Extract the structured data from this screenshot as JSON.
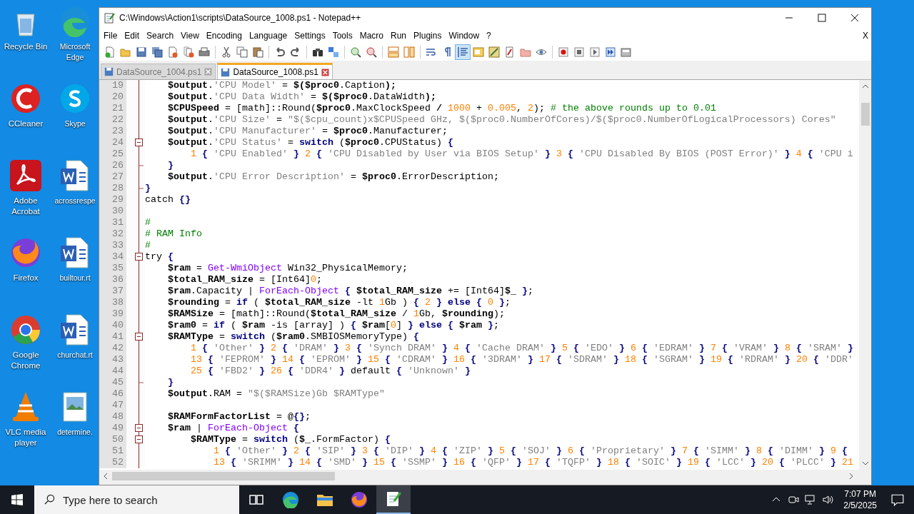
{
  "desktop_icons": [
    {
      "label": "Recycle Bin",
      "kind": "recycle"
    },
    {
      "label": "Microsoft Edge",
      "kind": "edge"
    },
    {
      "label": "CCleaner",
      "kind": "ccleaner"
    },
    {
      "label": "Skype",
      "kind": "skype"
    },
    {
      "label": "Adobe Acrobat",
      "kind": "acrobat"
    },
    {
      "label": "acrossrespe",
      "kind": "word"
    },
    {
      "label": "Firefox",
      "kind": "firefox"
    },
    {
      "label": "builtour.rt",
      "kind": "word"
    },
    {
      "label": "Google Chrome",
      "kind": "chrome"
    },
    {
      "label": "churchat.rt",
      "kind": "word"
    },
    {
      "label": "VLC media player",
      "kind": "vlc"
    },
    {
      "label": "determine.",
      "kind": "image"
    }
  ],
  "window": {
    "title": "C:\\Windows\\Action1\\scripts\\DataSource_1008.ps1 - Notepad++",
    "menu": [
      "File",
      "Edit",
      "Search",
      "View",
      "Encoding",
      "Language",
      "Settings",
      "Tools",
      "Macro",
      "Run",
      "Plugins",
      "Window",
      "?"
    ],
    "close_doc": "X",
    "indent_guide_on": true,
    "tabs": [
      {
        "label": "DataSource_1004.ps1",
        "selected": false
      },
      {
        "label": "DataSource_1008.ps1",
        "selected": true
      }
    ]
  },
  "editor": {
    "lines": [
      {
        "n": "19",
        "tokens": [
          {
            "kind": "var",
            "text": "    $output"
          },
          {
            "kind": "plain",
            "text": "."
          },
          {
            "kind": "str",
            "text": "'CPU Model'"
          },
          {
            "kind": "plain",
            "text": " = "
          },
          {
            "kind": "var",
            "text": "$($proc0"
          },
          {
            "kind": "plain",
            "text": ".Caption"
          },
          {
            "kind": "var",
            "text": ");"
          }
        ]
      },
      {
        "n": "20",
        "tokens": [
          {
            "kind": "var",
            "text": "    $output"
          },
          {
            "kind": "plain",
            "text": "."
          },
          {
            "kind": "str",
            "text": "'CPU Data Width'"
          },
          {
            "kind": "plain",
            "text": " = "
          },
          {
            "kind": "var",
            "text": "$($proc0"
          },
          {
            "kind": "plain",
            "text": ".DataWidth"
          },
          {
            "kind": "var",
            "text": ");"
          }
        ]
      },
      {
        "n": "21",
        "tokens": [
          {
            "kind": "var",
            "text": "    $CPUSpeed"
          },
          {
            "kind": "plain",
            "text": " = [math]::Round("
          },
          {
            "kind": "var",
            "text": "$proc0"
          },
          {
            "kind": "plain",
            "text": ".MaxClockSpeed "
          },
          {
            "kind": "var",
            "text": "/ "
          },
          {
            "kind": "num",
            "text": "1000"
          },
          {
            "kind": "plain",
            "text": " + "
          },
          {
            "kind": "num",
            "text": "0.005"
          },
          {
            "kind": "plain",
            "text": ", "
          },
          {
            "kind": "num",
            "text": "2"
          },
          {
            "kind": "plain",
            "text": "); "
          },
          {
            "kind": "comment",
            "text": "# the above rounds up to 0.01"
          }
        ]
      },
      {
        "n": "22",
        "tokens": [
          {
            "kind": "var",
            "text": "    $output"
          },
          {
            "kind": "plain",
            "text": "."
          },
          {
            "kind": "str",
            "text": "'CPU Size'"
          },
          {
            "kind": "plain",
            "text": " = "
          },
          {
            "kind": "str",
            "text": "\"$($cpu_count)x$CPUSpeed GHz, $($proc0.NumberOfCores)/$($proc0.NumberOfLogicalProcessors) Cores\""
          }
        ]
      },
      {
        "n": "23",
        "tokens": [
          {
            "kind": "var",
            "text": "    $output"
          },
          {
            "kind": "plain",
            "text": "."
          },
          {
            "kind": "str",
            "text": "'CPU Manufacturer'"
          },
          {
            "kind": "plain",
            "text": " = "
          },
          {
            "kind": "var",
            "text": "$proc0"
          },
          {
            "kind": "plain",
            "text": ".Manufacturer;"
          }
        ]
      },
      {
        "n": "24",
        "kind": "fold_start",
        "tokens": [
          {
            "kind": "var",
            "text": "    $output"
          },
          {
            "kind": "plain",
            "text": "."
          },
          {
            "kind": "str",
            "text": "'CPU Status'"
          },
          {
            "kind": "plain",
            "text": " = "
          },
          {
            "kind": "keyword",
            "text": "switch"
          },
          {
            "kind": "plain",
            "text": " ("
          },
          {
            "kind": "var",
            "text": "$proc0"
          },
          {
            "kind": "plain",
            "text": ".CPUStatus) "
          },
          {
            "kind": "brace",
            "text": "{"
          }
        ]
      },
      {
        "n": "25",
        "tokens": [
          {
            "kind": "num",
            "text": "        1"
          },
          {
            "kind": "brace",
            "text": " { "
          },
          {
            "kind": "str",
            "text": "'CPU Enabled'"
          },
          {
            "kind": "brace",
            "text": " } "
          },
          {
            "kind": "num",
            "text": "2"
          },
          {
            "kind": "brace",
            "text": " { "
          },
          {
            "kind": "str",
            "text": "'CPU Disabled by User via BIOS Setup'"
          },
          {
            "kind": "brace",
            "text": " } "
          },
          {
            "kind": "num",
            "text": "3"
          },
          {
            "kind": "brace",
            "text": " { "
          },
          {
            "kind": "str",
            "text": "'CPU Disabled By BIOS (POST Error)'"
          },
          {
            "kind": "brace",
            "text": " } "
          },
          {
            "kind": "num",
            "text": "4"
          },
          {
            "kind": "brace",
            "text": " { "
          },
          {
            "kind": "str",
            "text": "'CPU i"
          }
        ]
      },
      {
        "n": "26",
        "kind": "fold_end",
        "tokens": [
          {
            "kind": "brace",
            "text": "    }"
          }
        ]
      },
      {
        "n": "27",
        "tokens": [
          {
            "kind": "var",
            "text": "    $output"
          },
          {
            "kind": "plain",
            "text": "."
          },
          {
            "kind": "str",
            "text": "'CPU Error Description'"
          },
          {
            "kind": "plain",
            "text": " = "
          },
          {
            "kind": "var",
            "text": "$proc0"
          },
          {
            "kind": "plain",
            "text": ".ErrorDescription;"
          }
        ]
      },
      {
        "n": "28",
        "kind": "fold_end",
        "tokens": [
          {
            "kind": "brace",
            "text": "}"
          }
        ]
      },
      {
        "n": "29",
        "tokens": [
          {
            "kind": "plain",
            "text": "catch "
          },
          {
            "kind": "brace",
            "text": "{}"
          }
        ]
      },
      {
        "n": "30",
        "kind": "blank"
      },
      {
        "n": "31",
        "tokens": [
          {
            "kind": "comment",
            "text": "#"
          }
        ]
      },
      {
        "n": "32",
        "tokens": [
          {
            "kind": "comment",
            "text": "# RAM Info"
          }
        ]
      },
      {
        "n": "33",
        "tokens": [
          {
            "kind": "comment",
            "text": "#"
          }
        ]
      },
      {
        "n": "34",
        "kind": "fold_start",
        "tokens": [
          {
            "kind": "plain",
            "text": "try "
          },
          {
            "kind": "brace",
            "text": "{"
          }
        ]
      },
      {
        "n": "35",
        "tokens": [
          {
            "kind": "var",
            "text": "    $ram"
          },
          {
            "kind": "plain",
            "text": " = "
          },
          {
            "kind": "cmdlet",
            "text": "Get-WmiObject"
          },
          {
            "kind": "plain",
            "text": " Win32_PhysicalMemory;"
          }
        ]
      },
      {
        "n": "36",
        "tokens": [
          {
            "kind": "var",
            "text": "    $total_RAM_size"
          },
          {
            "kind": "plain",
            "text": " = [Int64]"
          },
          {
            "kind": "num",
            "text": "0"
          },
          {
            "kind": "plain",
            "text": ";"
          }
        ]
      },
      {
        "n": "37",
        "tokens": [
          {
            "kind": "var",
            "text": "    $ram"
          },
          {
            "kind": "plain",
            "text": ".Capacity | "
          },
          {
            "kind": "cmdlet",
            "text": "ForEach-Object"
          },
          {
            "kind": "brace",
            "text": " { "
          },
          {
            "kind": "var",
            "text": "$total_RAM_size"
          },
          {
            "kind": "plain",
            "text": " += [Int64]"
          },
          {
            "kind": "var",
            "text": "$_"
          },
          {
            "kind": "brace",
            "text": " }"
          },
          {
            "kind": "plain",
            "text": ";"
          }
        ]
      },
      {
        "n": "38",
        "tokens": [
          {
            "kind": "var",
            "text": "    $rounding"
          },
          {
            "kind": "plain",
            "text": " = "
          },
          {
            "kind": "keyword",
            "text": "if"
          },
          {
            "kind": "plain",
            "text": " ( "
          },
          {
            "kind": "var",
            "text": "$total_RAM_size"
          },
          {
            "kind": "plain",
            "text": " -lt "
          },
          {
            "kind": "num",
            "text": "1"
          },
          {
            "kind": "plain",
            "text": "Gb ) "
          },
          {
            "kind": "brace",
            "text": "{ "
          },
          {
            "kind": "num",
            "text": "2"
          },
          {
            "kind": "brace",
            "text": " } "
          },
          {
            "kind": "keyword",
            "text": "else"
          },
          {
            "kind": "brace",
            "text": " { "
          },
          {
            "kind": "num",
            "text": "0"
          },
          {
            "kind": "brace",
            "text": " }"
          },
          {
            "kind": "plain",
            "text": ";"
          }
        ]
      },
      {
        "n": "39",
        "tokens": [
          {
            "kind": "var",
            "text": "    $RAMSize"
          },
          {
            "kind": "plain",
            "text": " = [math]::Round("
          },
          {
            "kind": "var",
            "text": "$total_RAM_size"
          },
          {
            "kind": "plain",
            "text": " / "
          },
          {
            "kind": "num",
            "text": "1"
          },
          {
            "kind": "plain",
            "text": "Gb, "
          },
          {
            "kind": "var",
            "text": "$rounding"
          },
          {
            "kind": "plain",
            "text": ");"
          }
        ]
      },
      {
        "n": "40",
        "tokens": [
          {
            "kind": "var",
            "text": "    $ram0"
          },
          {
            "kind": "plain",
            "text": " = "
          },
          {
            "kind": "keyword",
            "text": "if"
          },
          {
            "kind": "plain",
            "text": " ( "
          },
          {
            "kind": "var",
            "text": "$ram"
          },
          {
            "kind": "plain",
            "text": " -is [array] ) "
          },
          {
            "kind": "brace",
            "text": "{ "
          },
          {
            "kind": "var",
            "text": "$ram"
          },
          {
            "kind": "plain",
            "text": "["
          },
          {
            "kind": "num",
            "text": "0"
          },
          {
            "kind": "plain",
            "text": "]"
          },
          {
            "kind": "brace",
            "text": " } "
          },
          {
            "kind": "keyword",
            "text": "else"
          },
          {
            "kind": "brace",
            "text": " { "
          },
          {
            "kind": "var",
            "text": "$ram"
          },
          {
            "kind": "brace",
            "text": " }"
          },
          {
            "kind": "plain",
            "text": ";"
          }
        ]
      },
      {
        "n": "41",
        "kind": "fold_start",
        "tokens": [
          {
            "kind": "var",
            "text": "    $RAMType"
          },
          {
            "kind": "plain",
            "text": " = "
          },
          {
            "kind": "keyword",
            "text": "switch"
          },
          {
            "kind": "plain",
            "text": " ("
          },
          {
            "kind": "var",
            "text": "$ram0"
          },
          {
            "kind": "plain",
            "text": ".SMBIOSMemoryType) "
          },
          {
            "kind": "brace",
            "text": "{"
          }
        ]
      },
      {
        "n": "42",
        "tokens": [
          {
            "kind": "num",
            "text": "        1"
          },
          {
            "kind": "brace",
            "text": " { "
          },
          {
            "kind": "str",
            "text": "'Other'"
          },
          {
            "kind": "brace",
            "text": " } "
          },
          {
            "kind": "num",
            "text": "2"
          },
          {
            "kind": "brace",
            "text": " { "
          },
          {
            "kind": "str",
            "text": "'DRAM'"
          },
          {
            "kind": "brace",
            "text": " } "
          },
          {
            "kind": "num",
            "text": "3"
          },
          {
            "kind": "brace",
            "text": " { "
          },
          {
            "kind": "str",
            "text": "'Synch DRAM'"
          },
          {
            "kind": "brace",
            "text": " } "
          },
          {
            "kind": "num",
            "text": "4"
          },
          {
            "kind": "brace",
            "text": " { "
          },
          {
            "kind": "str",
            "text": "'Cache DRAM'"
          },
          {
            "kind": "brace",
            "text": " } "
          },
          {
            "kind": "num",
            "text": "5"
          },
          {
            "kind": "brace",
            "text": " { "
          },
          {
            "kind": "str",
            "text": "'EDO'"
          },
          {
            "kind": "brace",
            "text": " } "
          },
          {
            "kind": "num",
            "text": "6"
          },
          {
            "kind": "brace",
            "text": " { "
          },
          {
            "kind": "str",
            "text": "'EDRAM'"
          },
          {
            "kind": "brace",
            "text": " } "
          },
          {
            "kind": "num",
            "text": "7"
          },
          {
            "kind": "brace",
            "text": " { "
          },
          {
            "kind": "str",
            "text": "'VRAM'"
          },
          {
            "kind": "brace",
            "text": " } "
          },
          {
            "kind": "num",
            "text": "8"
          },
          {
            "kind": "brace",
            "text": " { "
          },
          {
            "kind": "str",
            "text": "'SRAM'"
          },
          {
            "kind": "brace",
            "text": " }"
          }
        ]
      },
      {
        "n": "43",
        "tokens": [
          {
            "kind": "num",
            "text": "        13"
          },
          {
            "kind": "brace",
            "text": " { "
          },
          {
            "kind": "str",
            "text": "'FEPROM'"
          },
          {
            "kind": "brace",
            "text": " } "
          },
          {
            "kind": "num",
            "text": "14"
          },
          {
            "kind": "brace",
            "text": " { "
          },
          {
            "kind": "str",
            "text": "'EPROM'"
          },
          {
            "kind": "brace",
            "text": " } "
          },
          {
            "kind": "num",
            "text": "15"
          },
          {
            "kind": "brace",
            "text": " { "
          },
          {
            "kind": "str",
            "text": "'CDRAM'"
          },
          {
            "kind": "brace",
            "text": " } "
          },
          {
            "kind": "num",
            "text": "16"
          },
          {
            "kind": "brace",
            "text": " { "
          },
          {
            "kind": "str",
            "text": "'3DRAM'"
          },
          {
            "kind": "brace",
            "text": " } "
          },
          {
            "kind": "num",
            "text": "17"
          },
          {
            "kind": "brace",
            "text": " { "
          },
          {
            "kind": "str",
            "text": "'SDRAM'"
          },
          {
            "kind": "brace",
            "text": " } "
          },
          {
            "kind": "num",
            "text": "18"
          },
          {
            "kind": "brace",
            "text": " { "
          },
          {
            "kind": "str",
            "text": "'SGRAM'"
          },
          {
            "kind": "brace",
            "text": " } "
          },
          {
            "kind": "num",
            "text": "19"
          },
          {
            "kind": "brace",
            "text": " { "
          },
          {
            "kind": "str",
            "text": "'RDRAM'"
          },
          {
            "kind": "brace",
            "text": " } "
          },
          {
            "kind": "num",
            "text": "20"
          },
          {
            "kind": "brace",
            "text": " { "
          },
          {
            "kind": "str",
            "text": "'DDR'"
          }
        ]
      },
      {
        "n": "44",
        "tokens": [
          {
            "kind": "num",
            "text": "        25"
          },
          {
            "kind": "brace",
            "text": " { "
          },
          {
            "kind": "str",
            "text": "'FBD2'"
          },
          {
            "kind": "brace",
            "text": " } "
          },
          {
            "kind": "num",
            "text": "26"
          },
          {
            "kind": "brace",
            "text": " { "
          },
          {
            "kind": "str",
            "text": "'DDR4'"
          },
          {
            "kind": "brace",
            "text": " } "
          },
          {
            "kind": "plain",
            "text": "default"
          },
          {
            "kind": "brace",
            "text": " { "
          },
          {
            "kind": "str",
            "text": "'Unknown'"
          },
          {
            "kind": "brace",
            "text": " }"
          }
        ]
      },
      {
        "n": "45",
        "kind": "fold_end",
        "tokens": [
          {
            "kind": "brace",
            "text": "    }"
          }
        ]
      },
      {
        "n": "46",
        "tokens": [
          {
            "kind": "var",
            "text": "    $output"
          },
          {
            "kind": "plain",
            "text": ".RAM = "
          },
          {
            "kind": "str",
            "text": "\"$($RAMSize)Gb $RAMType\""
          }
        ]
      },
      {
        "n": "47",
        "kind": "blank"
      },
      {
        "n": "48",
        "tokens": [
          {
            "kind": "var",
            "text": "    $RAMFormFactorList"
          },
          {
            "kind": "plain",
            "text": " = @"
          },
          {
            "kind": "brace",
            "text": "{}"
          },
          {
            "kind": "plain",
            "text": ";"
          }
        ]
      },
      {
        "n": "49",
        "kind": "fold_start",
        "tokens": [
          {
            "kind": "var",
            "text": "    $ram"
          },
          {
            "kind": "plain",
            "text": " | "
          },
          {
            "kind": "cmdlet",
            "text": "ForEach-Object"
          },
          {
            "kind": "brace",
            "text": " {"
          }
        ]
      },
      {
        "n": "50",
        "kind": "fold_start",
        "tokens": [
          {
            "kind": "var",
            "text": "        $RAMType"
          },
          {
            "kind": "plain",
            "text": " = "
          },
          {
            "kind": "keyword",
            "text": "switch"
          },
          {
            "kind": "plain",
            "text": " ("
          },
          {
            "kind": "var",
            "text": "$_"
          },
          {
            "kind": "plain",
            "text": ".FormFactor) "
          },
          {
            "kind": "brace",
            "text": "{"
          }
        ]
      },
      {
        "n": "51",
        "tokens": [
          {
            "kind": "num",
            "text": "            1"
          },
          {
            "kind": "brace",
            "text": " { "
          },
          {
            "kind": "str",
            "text": "'Other'"
          },
          {
            "kind": "brace",
            "text": " } "
          },
          {
            "kind": "num",
            "text": "2"
          },
          {
            "kind": "brace",
            "text": " { "
          },
          {
            "kind": "str",
            "text": "'SIP'"
          },
          {
            "kind": "brace",
            "text": " } "
          },
          {
            "kind": "num",
            "text": "3"
          },
          {
            "kind": "brace",
            "text": " { "
          },
          {
            "kind": "str",
            "text": "'DIP'"
          },
          {
            "kind": "brace",
            "text": " } "
          },
          {
            "kind": "num",
            "text": "4"
          },
          {
            "kind": "brace",
            "text": " { "
          },
          {
            "kind": "str",
            "text": "'ZIP'"
          },
          {
            "kind": "brace",
            "text": " } "
          },
          {
            "kind": "num",
            "text": "5"
          },
          {
            "kind": "brace",
            "text": " { "
          },
          {
            "kind": "str",
            "text": "'SOJ'"
          },
          {
            "kind": "brace",
            "text": " } "
          },
          {
            "kind": "num",
            "text": "6"
          },
          {
            "kind": "brace",
            "text": " { "
          },
          {
            "kind": "str",
            "text": "'Proprietary'"
          },
          {
            "kind": "brace",
            "text": " } "
          },
          {
            "kind": "num",
            "text": "7"
          },
          {
            "kind": "brace",
            "text": " { "
          },
          {
            "kind": "str",
            "text": "'SIMM'"
          },
          {
            "kind": "brace",
            "text": " } "
          },
          {
            "kind": "num",
            "text": "8"
          },
          {
            "kind": "brace",
            "text": " { "
          },
          {
            "kind": "str",
            "text": "'DIMM'"
          },
          {
            "kind": "brace",
            "text": " } "
          },
          {
            "kind": "num",
            "text": "9"
          },
          {
            "kind": "brace",
            "text": " {"
          }
        ]
      },
      {
        "n": "52",
        "tokens": [
          {
            "kind": "num",
            "text": "            13"
          },
          {
            "kind": "brace",
            "text": " { "
          },
          {
            "kind": "str",
            "text": "'SRIMM'"
          },
          {
            "kind": "brace",
            "text": " } "
          },
          {
            "kind": "num",
            "text": "14"
          },
          {
            "kind": "brace",
            "text": " { "
          },
          {
            "kind": "str",
            "text": "'SMD'"
          },
          {
            "kind": "brace",
            "text": " } "
          },
          {
            "kind": "num",
            "text": "15"
          },
          {
            "kind": "brace",
            "text": " { "
          },
          {
            "kind": "str",
            "text": "'SSMP'"
          },
          {
            "kind": "brace",
            "text": " } "
          },
          {
            "kind": "num",
            "text": "16"
          },
          {
            "kind": "brace",
            "text": " { "
          },
          {
            "kind": "str",
            "text": "'QFP'"
          },
          {
            "kind": "brace",
            "text": " } "
          },
          {
            "kind": "num",
            "text": "17"
          },
          {
            "kind": "brace",
            "text": " { "
          },
          {
            "kind": "str",
            "text": "'TQFP'"
          },
          {
            "kind": "brace",
            "text": " } "
          },
          {
            "kind": "num",
            "text": "18"
          },
          {
            "kind": "brace",
            "text": " { "
          },
          {
            "kind": "str",
            "text": "'SOIC'"
          },
          {
            "kind": "brace",
            "text": " } "
          },
          {
            "kind": "num",
            "text": "19"
          },
          {
            "kind": "brace",
            "text": " { "
          },
          {
            "kind": "str",
            "text": "'LCC'"
          },
          {
            "kind": "brace",
            "text": " } "
          },
          {
            "kind": "num",
            "text": "20"
          },
          {
            "kind": "brace",
            "text": " { "
          },
          {
            "kind": "str",
            "text": "'PLCC'"
          },
          {
            "kind": "brace",
            "text": " } "
          },
          {
            "kind": "num",
            "text": "21"
          }
        ]
      }
    ]
  },
  "taskbar": {
    "search": {
      "placeholder": "Type here to search"
    },
    "apps": [
      {
        "kind": "taskview",
        "active": false
      },
      {
        "kind": "edge",
        "active": false
      },
      {
        "kind": "explorer",
        "active": false
      },
      {
        "kind": "firefox",
        "active": false
      },
      {
        "kind": "notepad",
        "active": true
      }
    ],
    "time": "7:07 PM",
    "date": "2/5/2025"
  }
}
